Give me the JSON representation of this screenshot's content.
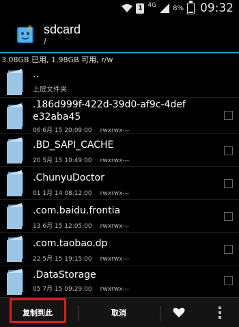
{
  "status_bar": {
    "network": "4G",
    "sim": "1",
    "battery_percent": "8%",
    "time": "09:32"
  },
  "header": {
    "title": "sdcard",
    "path": "/"
  },
  "storage_info": "3.08GB 已用, 1.98GB 可用, r/w",
  "files": [
    {
      "name": "..",
      "subtitle": "上层文件夹",
      "date": "",
      "perm": "",
      "checkbox": false
    },
    {
      "name": ".186d999f-422d-39d0-af9c-4defe32aba45",
      "subtitle": "",
      "date": "06 6月 15 20:09:00",
      "perm": "rwxrwx---",
      "checkbox": true
    },
    {
      "name": ".BD_SAPI_CACHE",
      "subtitle": "",
      "date": "20 5月 15 10:49:00",
      "perm": "rwxrwx---",
      "checkbox": true
    },
    {
      "name": ".ChunyuDoctor",
      "subtitle": "",
      "date": "01 1月 14 08:12:00",
      "perm": "rwxrwx---",
      "checkbox": true
    },
    {
      "name": ".com.baidu.frontia",
      "subtitle": "",
      "date": "13 6月 15 12:05:00",
      "perm": "rwxrwx---",
      "checkbox": true
    },
    {
      "name": ".com.taobao.dp",
      "subtitle": "",
      "date": "22 5月 15 19:15:00",
      "perm": "rwxrwx---",
      "checkbox": true
    },
    {
      "name": ".DataStorage",
      "subtitle": "",
      "date": "05 7月 15 09:29:00",
      "perm": "rwxrwx---",
      "checkbox": true
    }
  ],
  "bottom_bar": {
    "copy_label": "复制到此",
    "cancel_label": "取消",
    "favorite_icon": "heart-icon",
    "more_icon": "more-vert-icon"
  },
  "colors": {
    "accent": "#1f9ed6",
    "highlight": "#e11b1b"
  }
}
